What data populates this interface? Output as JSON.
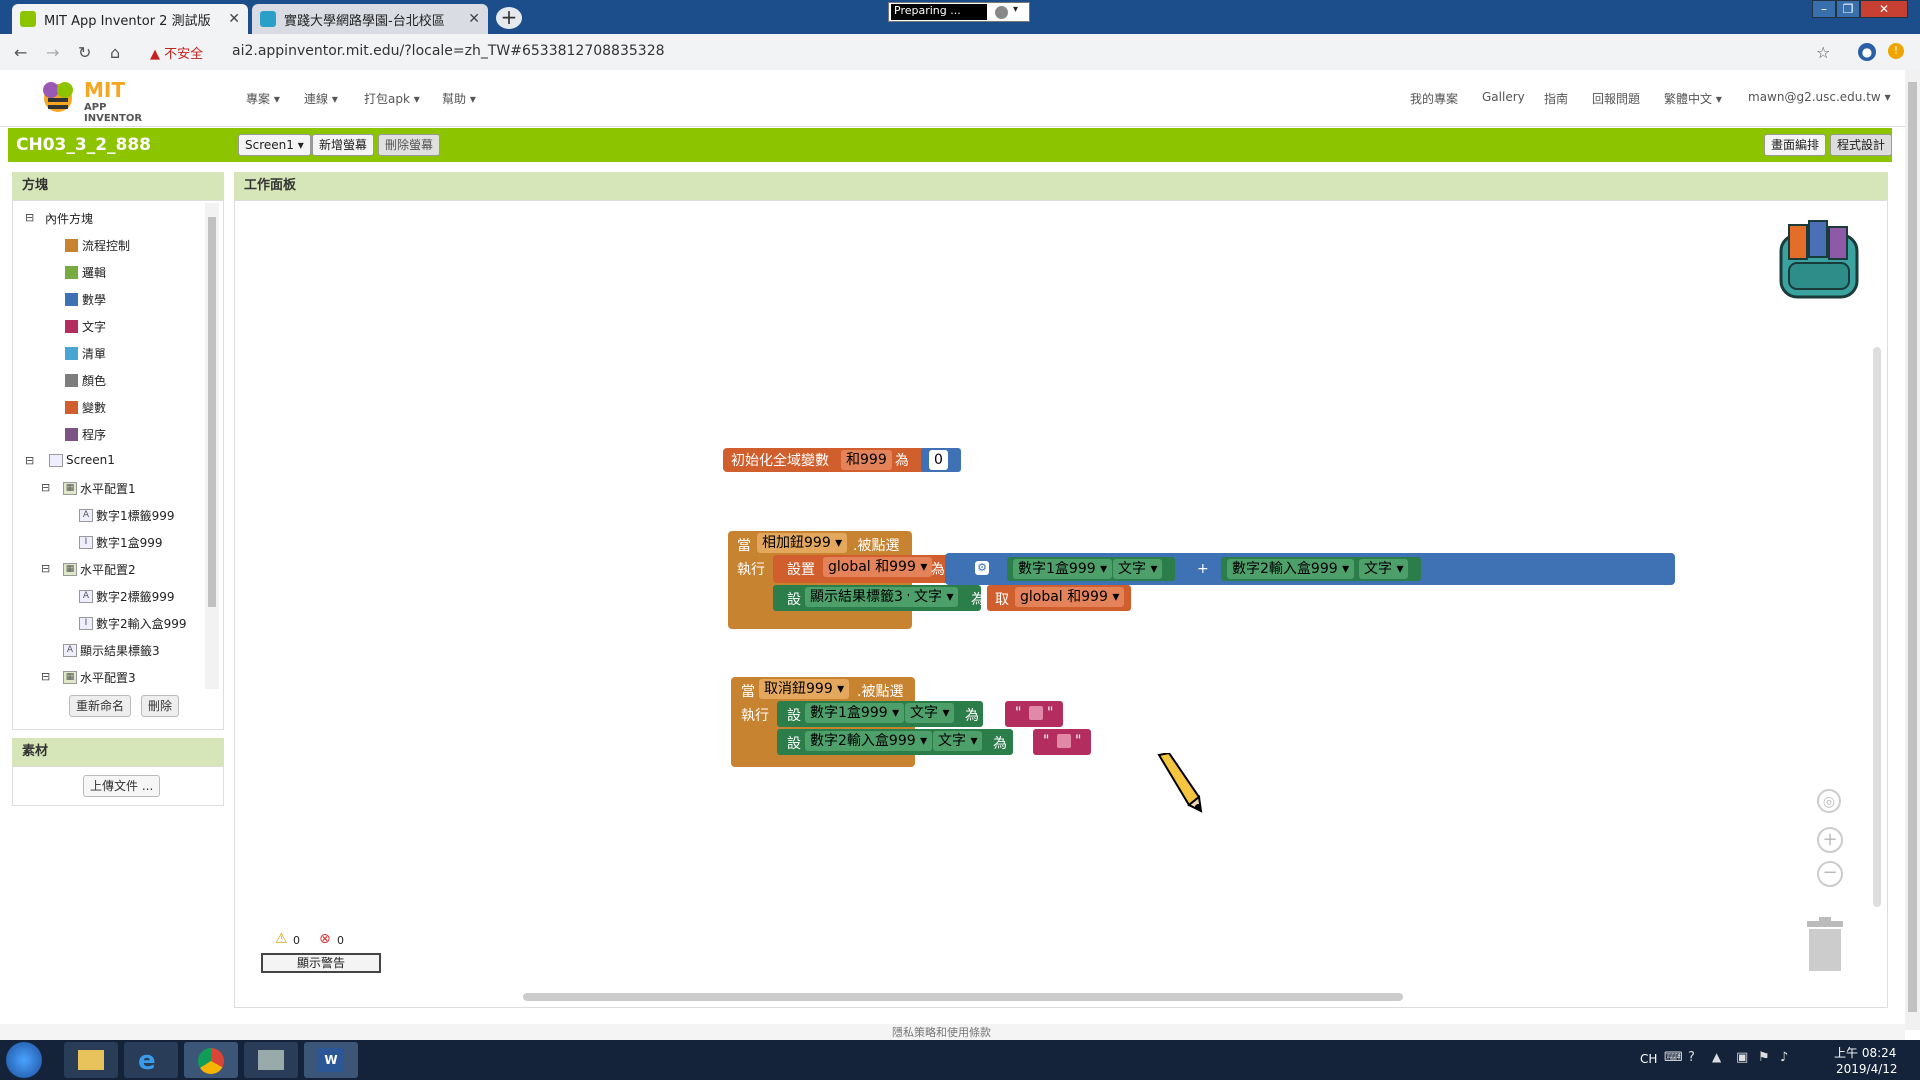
{
  "browser": {
    "tabs": [
      {
        "label": "MIT App Inventor 2 測試版",
        "active": true
      },
      {
        "label": "實踐大學網路學園-台北校區",
        "active": false
      }
    ],
    "close_glyph": "✕",
    "new_tab_glyph": "+",
    "preparing_label": "Preparing ...",
    "security_label": "不安全",
    "url": "ai2.appinventor.mit.edu/?locale=zh_TW#6533812708835328"
  },
  "app": {
    "logo_text": "MIT",
    "logo_subtext": "APP INVENTOR",
    "left_menus": [
      "專案",
      "連線",
      "打包apk",
      "幫助"
    ],
    "right_menus": [
      "我的專案",
      "Gallery",
      "指南",
      "回報問題",
      "繁體中文",
      "mawn@g2.usc.edu.tw"
    ],
    "project_name": "CH03_3_2_888",
    "screen_select": "Screen1",
    "add_screen": "新增螢幕",
    "remove_screen": "刪除螢幕",
    "designer_btn": "畫面編排",
    "blocks_btn": "程式設計"
  },
  "blocks_panel": {
    "title": "方塊",
    "builtin_label": "內件方塊",
    "builtin_items": [
      {
        "label": "流程控制",
        "color": "#c88330"
      },
      {
        "label": "邏輯",
        "color": "#77ab41"
      },
      {
        "label": "數學",
        "color": "#3f71b5"
      },
      {
        "label": "文字",
        "color": "#b32d5e"
      },
      {
        "label": "清單",
        "color": "#49a6d4"
      },
      {
        "label": "顏色",
        "color": "#7d7d7d"
      },
      {
        "label": "變數",
        "color": "#d05f2d"
      },
      {
        "label": "程序",
        "color": "#7c5385"
      }
    ],
    "screen_label": "Screen1",
    "components": [
      {
        "label": "水平配置1",
        "level": 1,
        "icon": "H"
      },
      {
        "label": "數字1標籤999",
        "level": 2,
        "icon": "A"
      },
      {
        "label": "數字1盒999",
        "level": 2,
        "icon": "I"
      },
      {
        "label": "水平配置2",
        "level": 1,
        "icon": "H"
      },
      {
        "label": "數字2標籤999",
        "level": 2,
        "icon": "A"
      },
      {
        "label": "數字2輸入盒999",
        "level": 2,
        "icon": "I"
      },
      {
        "label": "顯示結果標籤3",
        "level": 1,
        "icon": "A"
      },
      {
        "label": "水平配置3",
        "level": 1,
        "icon": "H"
      }
    ],
    "rename_btn": "重新命名",
    "delete_btn": "刪除"
  },
  "assets_panel": {
    "title": "素材",
    "upload_btn": "上傳文件 ..."
  },
  "workspace": {
    "title": "工作面板",
    "global_block": {
      "label": "初始化全域變數",
      "name": "和999",
      "as": "為",
      "value": "0"
    },
    "event1": {
      "when": "當",
      "component": "相加鈕999",
      "event": ".被點選",
      "do": "執行",
      "set_label": "設置",
      "var": "global 和999",
      "as": "為",
      "left_comp": "數字1盒999",
      "prop": "文字",
      "plus": "+",
      "right_comp": "數字2輸入盒999",
      "set2": "設",
      "comp2": "顯示結果標籤3",
      "get": "取",
      "get_var": "global 和999"
    },
    "event2": {
      "when": "當",
      "component": "取消鈕999",
      "event": ".被點選",
      "do": "執行",
      "set": "設",
      "comp1": "數字1盒999",
      "comp2": "數字2輸入盒999",
      "prop": "文字",
      "as": "為",
      "quote": "\""
    },
    "warnings_count": "0",
    "errors_count": "0",
    "show_warnings_btn": "顯示警告"
  },
  "status_footer": "隱私策略和使用條款",
  "taskbar": {
    "lang": "CH",
    "time": "上午 08:24",
    "date": "2019/4/12"
  }
}
